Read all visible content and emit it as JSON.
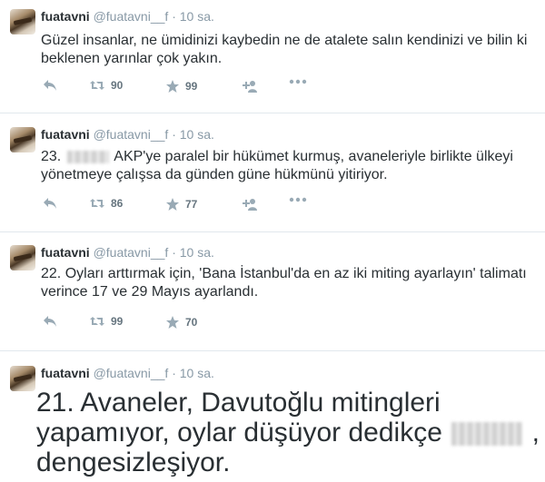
{
  "tweets": [
    {
      "name": "fuatavni",
      "handle": "@fuatavni__f",
      "sep": "·",
      "time": "10 sa.",
      "text": "Güzel insanlar, ne ümidinizi kaybedin ne de atalete salın kendinizi ve bilin ki beklenen yarınlar çok yakın.",
      "retweets": "90",
      "favorites": "99"
    },
    {
      "name": "fuatavni",
      "handle": "@fuatavni__f",
      "sep": "·",
      "time": "10 sa.",
      "num": "23.",
      "text": "AKP'ye paralel bir hükümet kurmuş, avaneleriyle birlikte ülkeyi yönetmeye çalışsa da günden güne hükmünü yitiriyor.",
      "retweets": "86",
      "favorites": "77"
    },
    {
      "name": "fuatavni",
      "handle": "@fuatavni__f",
      "sep": "·",
      "time": "10 sa.",
      "text": "22. Oyları arttırmak için, 'Bana İstanbul'da en az iki miting ayarlayın' talimatı verince 17 ve 29 Mayıs ayarlandı.",
      "retweets": "99",
      "favorites": "70"
    },
    {
      "name": "fuatavni",
      "handle": "@fuatavni__f",
      "sep": "·",
      "time": "10 sa.",
      "text_a": "21. Avaneler, Davutoğlu mitingleri yapamıyor, oylar düşüyor dedikçe",
      "text_b": ", dengesizleşiyor."
    }
  ],
  "icons": {
    "reply": "reply-icon",
    "retweet": "retweet-icon",
    "favorite": "star-icon",
    "follow": "follow-icon",
    "more": "more-icon"
  },
  "colors": {
    "icon": "#99aab5",
    "text": "#292f33",
    "meta": "#8899a6",
    "divider": "#e1e8ed"
  }
}
